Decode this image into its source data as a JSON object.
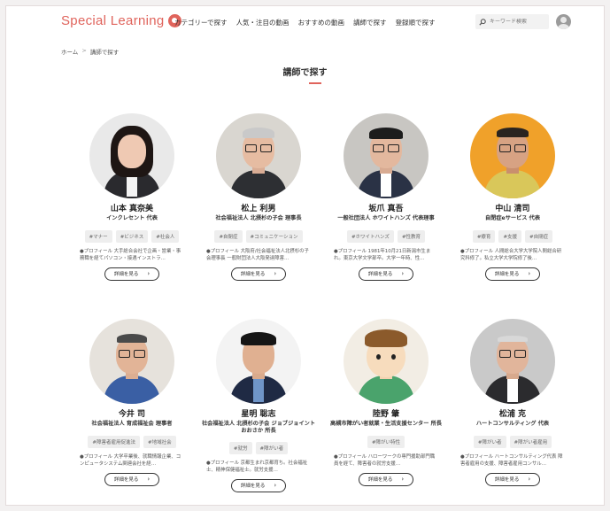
{
  "header": {
    "logo": "Special Learning",
    "nav": [
      "カテゴリーで探す",
      "人気・注目の動画",
      "おすすめの動画",
      "講師で探す",
      "登録順で探す"
    ],
    "search_placeholder": "キーワード検索"
  },
  "breadcrumb": [
    "ホーム",
    "講師で探す"
  ],
  "page_title": "講師で探す",
  "button_label": "詳細を見る",
  "accent_color": "#e0645c",
  "instructors": [
    {
      "name": "山本 真奈美",
      "org": "インクレセント 代表",
      "tags": [
        "#マナー",
        "#ビジネス",
        "#社会人"
      ],
      "desc": "●プロフィール 大手総合会社で企画・営業・事務職を経てパソコン・接遇インストラ…"
    },
    {
      "name": "松上 利男",
      "org": "社会福祉法人 北摂杉の子会 理事長",
      "tags": [
        "#自閉症",
        "#コミュニケーション"
      ],
      "desc": "●プロフィール 大阪府/社会福祉法人北摂杉の子会理事長 一般財団法人大阪発達障害…"
    },
    {
      "name": "坂爪 真吾",
      "org": "一般社団法人 ホワイトハンズ 代表理事",
      "tags": [
        "#ホワイトハンズ",
        "#性教育"
      ],
      "desc": "●プロフィール 1981年10月21日新潟市生まれ。東京大学文学部卒。大学一年時、性…"
    },
    {
      "name": "中山 清司",
      "org": "自閉症eサービス 代表",
      "tags": [
        "#療育",
        "#支援",
        "#自閉症"
      ],
      "desc": "●プロフィール 人間総合大学大学院人間総合研究科修了。私立大学大学院修了後…"
    },
    {
      "name": "今井 司",
      "org": "社会福祉法人 育成福祉会 理事者",
      "tags": [
        "#障害者雇用促進法",
        "#地域社会"
      ],
      "desc": "●プロフィール 大学卒業後、就職情報企業、コンピュータシステム関連会社を経…"
    },
    {
      "name": "星明 聡志",
      "org": "社会福祉法人 北摂杉の子会 ジョブジョイントおおさか 所長",
      "tags": [
        "#就労",
        "#障がい者"
      ],
      "desc": "●プロフィール 京都生まれ京都育ち。社会福祉士、精神保健福祉士。就労支援…"
    },
    {
      "name": "陸野 肇",
      "org": "高槻市障がい者就業・生活支援センター 所長",
      "tags": [
        "#障がい特性"
      ],
      "desc": "●プロフィール ハローワークの専門援助部門職員を経て、障害者の就労支援…"
    },
    {
      "name": "松浦 克",
      "org": "ハートコンサルティング 代表",
      "tags": [
        "#障がい者",
        "#障がい者雇用"
      ],
      "desc": "●プロフィール ハートコンサルティング代表 障害者雇用の支援、障害者雇用コンサル…"
    }
  ]
}
